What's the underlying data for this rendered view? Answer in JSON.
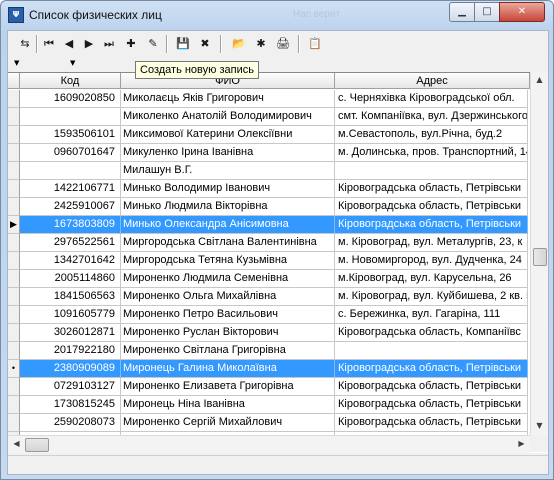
{
  "window": {
    "title": "Список физических лиц",
    "faded_title_text": "Нас верит",
    "min_glyph": "▁",
    "max_glyph": "□",
    "close_glyph": "✕"
  },
  "app_icon_glyph": "Ψ",
  "toolbar": {
    "buttons": [
      {
        "name": "filter-reset-icon",
        "glyph": "⇆"
      },
      {
        "name": "first-record-icon",
        "glyph": "⏮"
      },
      {
        "name": "prev-record-icon",
        "glyph": "◀"
      },
      {
        "name": "next-record-icon",
        "glyph": "▶"
      },
      {
        "name": "last-record-icon",
        "glyph": "⏭"
      },
      {
        "name": "new-record-icon",
        "glyph": "✚"
      },
      {
        "name": "edit-record-icon",
        "glyph": "✎"
      },
      {
        "name": "save-icon",
        "glyph": "💾"
      },
      {
        "name": "delete-record-icon",
        "glyph": "✖"
      },
      {
        "name": "open-folder-icon",
        "glyph": "📂"
      },
      {
        "name": "select-icon",
        "glyph": "✱"
      },
      {
        "name": "print-icon",
        "glyph": "🖨"
      },
      {
        "name": "clipboard-icon",
        "glyph": "📋"
      }
    ],
    "tooltip": "Создать новую запись"
  },
  "filter": {
    "dropdown_glyph": "▼",
    "dropdown_glyph2": "▼"
  },
  "grid": {
    "columns": [
      "Код",
      "ФИО",
      "Адрес"
    ],
    "rows": [
      {
        "ind": "",
        "code": "1609020850",
        "fio": "Миколаєць Яків Григорович",
        "addr": "с. Черняхівка Кіровоградської обл."
      },
      {
        "ind": "",
        "code": "",
        "fio": "Миколенко Анатолій Володимирович",
        "addr": "смт. Компаніївка, вул. Дзержинського"
      },
      {
        "ind": "",
        "code": "1593506101",
        "fio": "Миксимової Катерини Олексіївни",
        "addr": "м.Севастополь, вул.Річна, буд.2"
      },
      {
        "ind": "",
        "code": "0960701647",
        "fio": "Микуленко Ірина Іванівна",
        "addr": "м. Долинська, пров. Транспортний, 14"
      },
      {
        "ind": "",
        "code": "",
        "fio": "Милашун В.Г.",
        "addr": ""
      },
      {
        "ind": "",
        "code": "1422106771",
        "fio": "Минько Володимир Іванович",
        "addr": "Кіровоградська область, Петрівськи"
      },
      {
        "ind": "",
        "code": "2425910067",
        "fio": "Минько Людмила Вікторівна",
        "addr": "Кіровоградська область, Петрівськи"
      },
      {
        "ind": "▶",
        "code": "1673803809",
        "fio": "Минько Олександра Анісимовна",
        "addr": "Кіровоградська область, Петрівськи",
        "sel": true
      },
      {
        "ind": "",
        "code": "2976522561",
        "fio": "Миргородська Світлана Валентинівна",
        "addr": "м. Кіровоград, вул. Металургів, 23, к"
      },
      {
        "ind": "",
        "code": "1342701642",
        "fio": "Миргородська Тетяна Кузьмівна",
        "addr": "м. Новомиргород, вул. Дудченка, 24"
      },
      {
        "ind": "",
        "code": "2005114860",
        "fio": "Мироненко Людмила Семенівна",
        "addr": "м.Кіровоград, вул. Карусельна, 26"
      },
      {
        "ind": "",
        "code": "1841506563",
        "fio": "Мироненко Ольга Михайлівна",
        "addr": "м. Кіровоград, вул. Куйбишева, 2 кв. 5"
      },
      {
        "ind": "",
        "code": "1091605779",
        "fio": "Мироненко Петро Васильович",
        "addr": "с. Бережинка, вул. Гагаріна, 111"
      },
      {
        "ind": "",
        "code": "3026012871",
        "fio": "Мироненко Руслан Вікторович",
        "addr": "Кіровоградська область, Компаніївс"
      },
      {
        "ind": "",
        "code": "2017922180",
        "fio": "Мироненко Світлана Григорівна",
        "addr": ""
      },
      {
        "ind": "•",
        "code": "2380909089",
        "fio": "Миронець Галина Миколаївна",
        "addr": "Кіровоградська область, Петрівськи",
        "sel": true
      },
      {
        "ind": "",
        "code": "0729103127",
        "fio": "Мироненко Елизавета Григорівна",
        "addr": "Кіровоградська область, Петрівськи"
      },
      {
        "ind": "",
        "code": "1730815245",
        "fio": "Миронець Ніна Іванівна",
        "addr": "Кіровоградська область, Петрівськи"
      },
      {
        "ind": "",
        "code": "2590208073",
        "fio": "Мироненко Сергій Михайлович",
        "addr": "Кіровоградська область, Петрівськи"
      },
      {
        "ind": "",
        "code": "",
        "fio": "",
        "addr": ""
      }
    ]
  },
  "scroll": {
    "up": "▲",
    "down": "▼",
    "left": "◀",
    "right": "▶"
  }
}
